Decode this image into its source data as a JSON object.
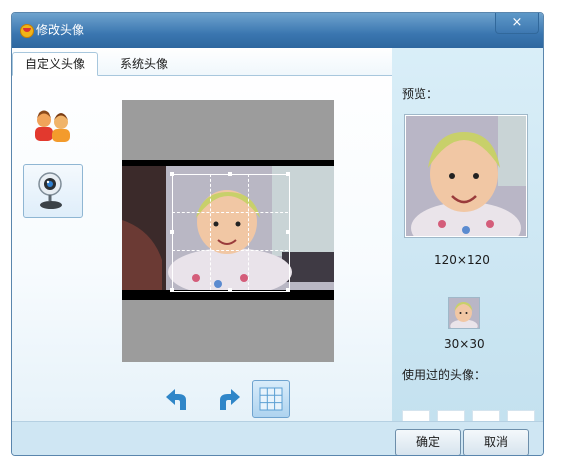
{
  "window": {
    "title": "修改头像",
    "close_symbol": "×"
  },
  "tabs": [
    {
      "label": "自定义头像",
      "active": true
    },
    {
      "label": "系统头像",
      "active": false
    }
  ],
  "sources": [
    {
      "name": "avatar-gallery",
      "icon": "people-icon"
    },
    {
      "name": "webcam",
      "icon": "webcam-icon",
      "selected": true
    }
  ],
  "toolbar": {
    "rotate_left": "rotate-left-icon",
    "rotate_right": "rotate-right-icon",
    "grid": "grid-icon"
  },
  "preview": {
    "label": "预览：",
    "large_size": "120×120",
    "small_size": "30×30",
    "history_label": "使用过的头像："
  },
  "buttons": {
    "ok": "确定",
    "cancel": "取消"
  },
  "colors": {
    "accent": "#3a76b0",
    "panel": "#cfe6f3"
  }
}
